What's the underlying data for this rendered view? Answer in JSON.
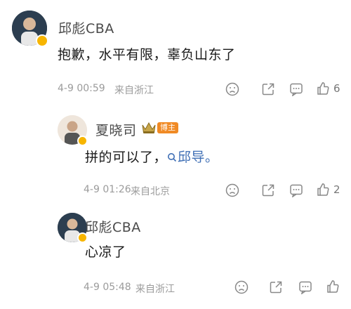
{
  "comments": [
    {
      "author": "邱彪CBA",
      "text": "抱歉，水平有限，辜负山东了",
      "time": "4-9 00:59",
      "location": "来自浙江",
      "likes": "6"
    },
    {
      "author": "夏晓司",
      "host_tag": "博主",
      "text_prefix": "拼的可以了，",
      "mention": "邱导。",
      "time": "4-9 01:26",
      "location": "来自北京",
      "likes": "2"
    },
    {
      "author": "邱彪CBA",
      "text": "心凉了",
      "time": "4-9 05:48",
      "location": "来自浙江",
      "likes": ""
    }
  ],
  "icons": [
    "frown-icon",
    "share-icon",
    "comment-icon",
    "thumbs-up-icon",
    "crown-icon",
    "search-icon"
  ],
  "colors": {
    "verified": "#f7b500",
    "host_tag": "#f08a24",
    "link": "#3f6fb5",
    "meta": "#9b9b9b"
  }
}
